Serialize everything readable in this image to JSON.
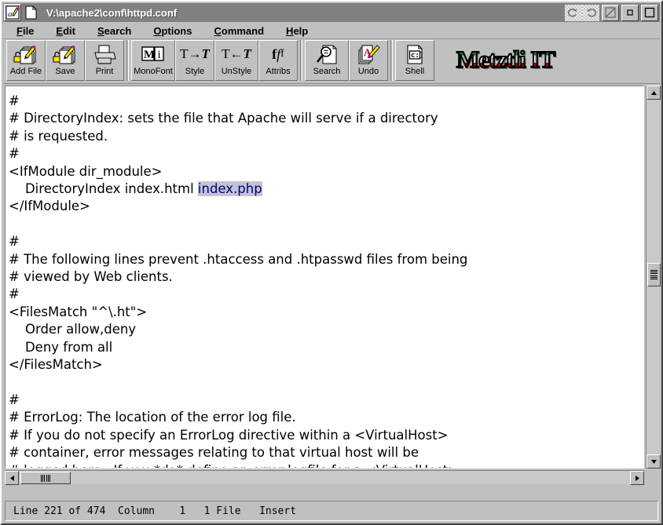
{
  "window": {
    "title": "V:\\apache2\\conf\\httpd.conf",
    "app_icon": "text-editor-pencil-icon",
    "document_icon": "blank-document-icon",
    "controls": {
      "undo_arrow": "undo-circular-arrow-icon",
      "redo_arrow": "redo-circular-arrow-icon",
      "close": "close-slash-icon",
      "minimize": "minimize-small-square-icon",
      "maximize": "maximize-large-square-icon"
    }
  },
  "menubar": {
    "items": [
      {
        "label": "File",
        "accel": "F"
      },
      {
        "label": "Edit",
        "accel": "E"
      },
      {
        "label": "Search",
        "accel": "S"
      },
      {
        "label": "Options",
        "accel": "O"
      },
      {
        "label": "Command",
        "accel": "C"
      },
      {
        "label": "Help",
        "accel": "H"
      }
    ]
  },
  "toolbar": {
    "groups": [
      {
        "buttons": [
          {
            "label": "Add File",
            "icon": "add-file-icon"
          },
          {
            "label": "Save",
            "icon": "save-icon"
          },
          {
            "label": "Print",
            "icon": "printer-icon"
          }
        ]
      },
      {
        "buttons": [
          {
            "label": "MonoFont",
            "icon": "monofont-icon",
            "glyph": "M i"
          },
          {
            "label": "Style",
            "icon": "style-icon",
            "glyph": "T→T"
          },
          {
            "label": "UnStyle",
            "icon": "unstyle-icon",
            "glyph": "T←T"
          },
          {
            "label": "Attribs",
            "icon": "attribs-icon",
            "glyph": "fƒf"
          }
        ]
      },
      {
        "buttons": [
          {
            "label": "Search",
            "icon": "search-magnifier-icon"
          },
          {
            "label": "Undo",
            "icon": "undo-document-icon"
          }
        ]
      },
      {
        "buttons": [
          {
            "label": "Shell",
            "icon": "shell-prompt-icon",
            "glyph": "c:]"
          }
        ]
      }
    ],
    "logo": {
      "text": "Metztli IT",
      "colors": {
        "top": "#00b000",
        "middle": "#ffffff",
        "bottom": "#d00000",
        "outline": "#000000"
      }
    }
  },
  "editor": {
    "lines_before_selection": "#\n# DirectoryIndex: sets the file that Apache will serve if a directory\n# is requested.\n#\n<IfModule dir_module>\n    DirectoryIndex index.html ",
    "selected_text": "index.php",
    "lines_after_selection": "\n</IfModule>\n\n#\n# The following lines prevent .htaccess and .htpasswd files from being\n# viewed by Web clients.\n#\n<FilesMatch \"^\\.ht\">\n    Order allow,deny\n    Deny from all\n</FilesMatch>\n\n#\n# ErrorLog: The location of the error log file.\n# If you do not specify an ErrorLog directive within a <VirtualHost>\n# container, error messages relating to that virtual host will be\n# logged here.  If you *do* define an error logfile for a <VirtualHost>",
    "selection_colors": {
      "background": "#c3c3d4",
      "text": "#000080"
    }
  },
  "scrollbars": {
    "vertical": {
      "up_icon": "scroll-up-arrow-icon",
      "down_icon": "scroll-down-arrow-icon"
    },
    "horizontal": {
      "left_icon": "scroll-left-arrow-icon",
      "right_icon": "scroll-right-arrow-icon"
    }
  },
  "statusbar": {
    "text": "Line 221 of 474  Column    1   1 File   Insert",
    "line_current": "221",
    "line_total": "474",
    "column": "1",
    "file_count": "1 File",
    "mode": "Insert"
  }
}
